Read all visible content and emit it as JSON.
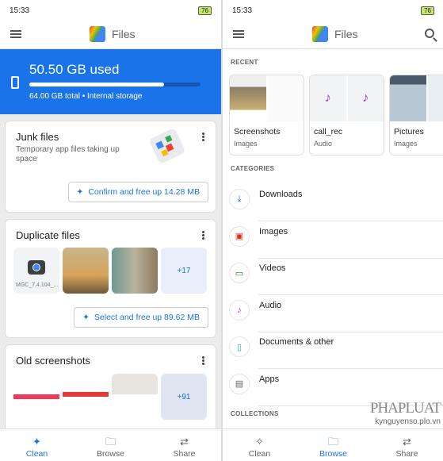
{
  "status": {
    "time": "15:33",
    "battery": "76"
  },
  "left": {
    "app_title": "Files",
    "storage": {
      "used": "50.50 GB used",
      "total": "64.00 GB total • Internal storage",
      "used_fraction": 0.789
    },
    "junk": {
      "title": "Junk files",
      "desc": "Temporary app files taking up space",
      "action": "Confirm and free up 14.28 MB"
    },
    "duplicate": {
      "title": "Duplicate files",
      "first_name": "MGC_7.4.104_...",
      "more": "+17",
      "action": "Select and free up 89.62 MB"
    },
    "old": {
      "title": "Old screenshots",
      "more": "+91"
    },
    "nav": [
      {
        "label": "Clean",
        "icon": "sparkle-icon",
        "active": true
      },
      {
        "label": "Browse",
        "icon": "browse-folder-icon"
      },
      {
        "label": "Share",
        "icon": "share-arrows-icon"
      }
    ]
  },
  "right": {
    "app_title": "Files",
    "recent_label": "RECENT",
    "recent": [
      {
        "name": "Screenshots",
        "type": "Images"
      },
      {
        "name": "call_rec",
        "type": "Audio"
      },
      {
        "name": "Pictures",
        "type": "Images"
      }
    ],
    "categories_label": "CATEGORIES",
    "categories": [
      {
        "label": "Downloads",
        "icon": "download-icon",
        "color": "#1a73e8"
      },
      {
        "label": "Images",
        "icon": "image-icon",
        "color": "#d93025"
      },
      {
        "label": "Videos",
        "icon": "video-icon",
        "color": "#188038"
      },
      {
        "label": "Audio",
        "icon": "music-note-icon",
        "color": "#9334e6"
      },
      {
        "label": "Documents & other",
        "icon": "document-icon",
        "color": "#12b5cb"
      },
      {
        "label": "Apps",
        "icon": "apps-icon",
        "color": "#5f6368"
      }
    ],
    "collections_label": "COLLECTIONS",
    "nav": [
      {
        "label": "Clean",
        "icon": "sparkle-icon"
      },
      {
        "label": "Browse",
        "icon": "browse-folder-icon",
        "active": true
      },
      {
        "label": "Share",
        "icon": "share-arrows-icon"
      }
    ]
  },
  "watermark": {
    "brand": "PHAPLUAT",
    "site": "kynguyenso.plo.vn"
  }
}
